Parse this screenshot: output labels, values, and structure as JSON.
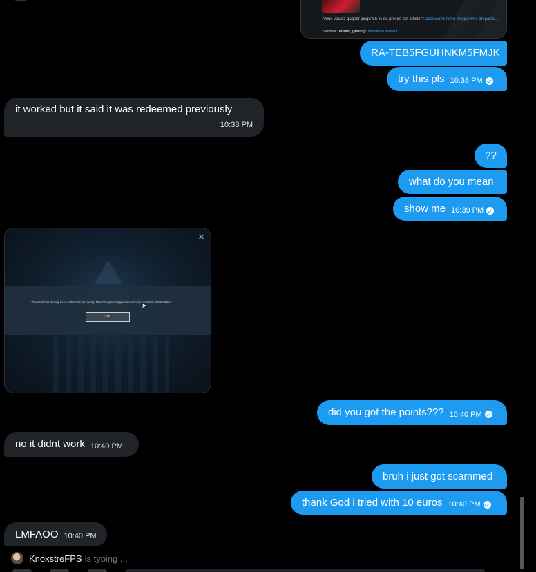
{
  "attachment_top": {
    "line1_text": "Vous voulez gagner jusqu'à 5 % du prix de cet article ?",
    "line1_link": "Découvrez notre programme de parrai...",
    "seller_label": "Vendeur :",
    "seller_name": "Instant_gaming",
    "contact_link": "Contacter le vendeur"
  },
  "messages": [
    {
      "id": "m1",
      "text": "RA-TEB5FGUHNKM5FMJK",
      "time": ""
    },
    {
      "id": "m2",
      "text": "try this pls",
      "time": "10:38 PM"
    },
    {
      "id": "m3",
      "text": "it worked but it said it was redeemed previously",
      "time": "10:38 PM"
    },
    {
      "id": "m4",
      "text": "??",
      "time": ""
    },
    {
      "id": "m5",
      "text": "what do you mean",
      "time": ""
    },
    {
      "id": "m6",
      "text": "show me",
      "time": "10:39 PM"
    },
    {
      "id": "m7",
      "text": "did you got the points???",
      "time": "10:40 PM"
    },
    {
      "id": "m8",
      "text": "no it didnt work",
      "time": "10:40 PM"
    },
    {
      "id": "m9",
      "text": "bruh i just got scammed",
      "time": ""
    },
    {
      "id": "m10",
      "text": "thank God i tried with 10 euros",
      "time": "10:40 PM"
    },
    {
      "id": "m11",
      "text": "LMFAOO",
      "time": "10:40 PM"
    }
  ],
  "screenshot": {
    "dialog_text": "This code has already been redeemed previously: https://support-riotgames.com/hc/en-us/articles/201752224",
    "ok_label": "OK",
    "close_glyph": "✕"
  },
  "typing": {
    "name": "KnoxstreFPS",
    "status": "is typing ..."
  },
  "colors": {
    "outgoing": "#1d9bf0",
    "incoming": "#202327",
    "background": "#000000"
  }
}
